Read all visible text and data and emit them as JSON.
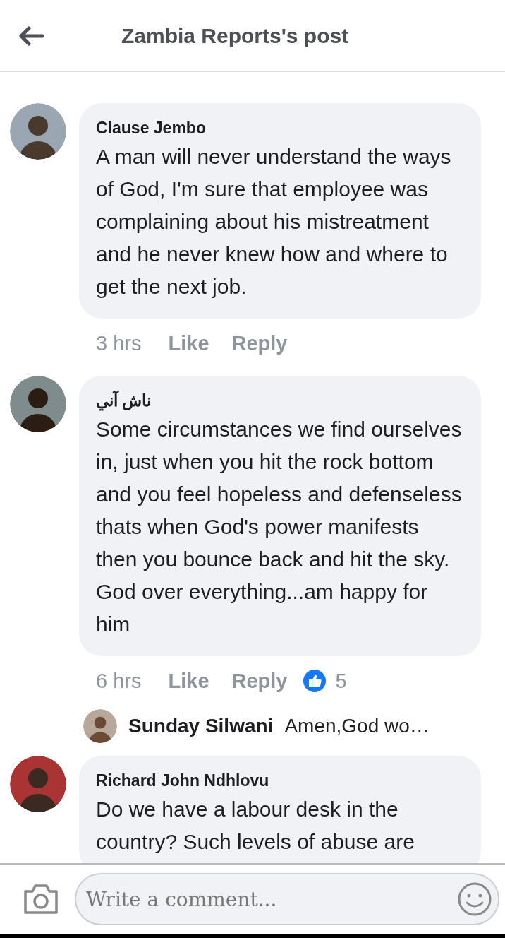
{
  "header": {
    "title": "Zambia Reports's post"
  },
  "comments": [
    {
      "kind": "comment",
      "name": "Clause Jembo",
      "text": "A man will never understand the ways of God, I'm sure that employee was complaining about his mistreatment and he never knew how and where to get the next job.",
      "time": "3 hrs",
      "like": "Like",
      "reply": "Reply"
    },
    {
      "kind": "comment",
      "name": "ناش آني",
      "text": "Some circumstances we find ourselves in, just when you hit the rock bottom and you feel hopeless and defenseless thats when God's power manifests then you bounce back and hit the sky.   God over everything...am happy for him",
      "time": "6 hrs",
      "like": "Like",
      "reply": "Reply",
      "reactions": "5"
    },
    {
      "kind": "reply",
      "name": "Sunday Silwani",
      "text": "Amen,God wo…"
    },
    {
      "kind": "comment",
      "name": "Richard John Ndhlovu",
      "text": "Do we have a labour desk in the country? Such levels of abuse are"
    }
  ],
  "composer": {
    "placeholder": "Write a comment..."
  }
}
